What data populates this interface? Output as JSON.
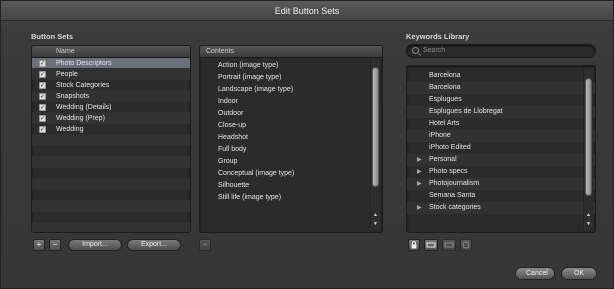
{
  "window": {
    "title": "Edit Button Sets"
  },
  "button_sets": {
    "label": "Button Sets",
    "column_name": "Name",
    "rows": [
      {
        "name": "Photo Descriptors",
        "checked": true,
        "selected": true
      },
      {
        "name": "People",
        "checked": true,
        "selected": false
      },
      {
        "name": "Stock Categories",
        "checked": true,
        "selected": false
      },
      {
        "name": "Snapshots",
        "checked": true,
        "selected": false
      },
      {
        "name": "Wedding (Details)",
        "checked": true,
        "selected": false
      },
      {
        "name": "Wedding (Prep)",
        "checked": true,
        "selected": false
      },
      {
        "name": "Wedding",
        "checked": true,
        "selected": false
      }
    ],
    "add_label": "+",
    "remove_label": "−",
    "import_label": "Import...",
    "export_label": "Export...",
    "contents_remove_label": "−"
  },
  "contents": {
    "header": "Contents",
    "items": [
      "Action (image type)",
      "Portrait (image type)",
      "Landscape (image type)",
      "Indoor",
      "Outdoor",
      "Close-up",
      "Headshot",
      "Full body",
      "Group",
      "Conceptual (image type)",
      "Silhouette",
      "Still life (image type)"
    ]
  },
  "keywords_library": {
    "label": "Keywords Library",
    "search_placeholder": "Search",
    "items": [
      {
        "name": "Barcelona",
        "expandable": false
      },
      {
        "name": "Barcelona",
        "expandable": false
      },
      {
        "name": "Esplugues",
        "expandable": false
      },
      {
        "name": "Esplugues de Llobregat",
        "expandable": false
      },
      {
        "name": "Hotel Arts",
        "expandable": false
      },
      {
        "name": "iPhone",
        "expandable": false
      },
      {
        "name": "iPhoto Edited",
        "expandable": false
      },
      {
        "name": "Personal",
        "expandable": true
      },
      {
        "name": "Photo specs",
        "expandable": true
      },
      {
        "name": "Photojournalism",
        "expandable": true
      },
      {
        "name": "Semana Santa",
        "expandable": false
      },
      {
        "name": "Stock categories",
        "expandable": true
      }
    ]
  },
  "dialog": {
    "cancel_label": "Cancel",
    "ok_label": "OK"
  }
}
